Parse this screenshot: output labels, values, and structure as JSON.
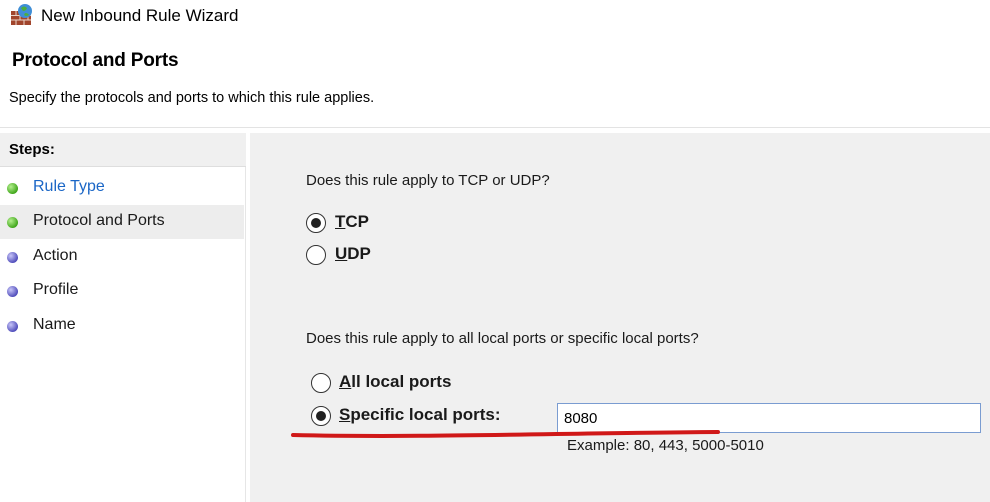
{
  "window": {
    "title": "New Inbound Rule Wizard",
    "icon": "firewall-rule-icon"
  },
  "header": {
    "title": "Protocol and Ports",
    "subtitle": "Specify the protocols and ports to which this rule applies."
  },
  "steps": {
    "title": "Steps:",
    "items": [
      {
        "label": "Rule Type",
        "state": "link",
        "dot": "green"
      },
      {
        "label": "Protocol and Ports",
        "state": "current",
        "dot": "green"
      },
      {
        "label": "Action",
        "state": "pending",
        "dot": "blue"
      },
      {
        "label": "Profile",
        "state": "pending",
        "dot": "blue"
      },
      {
        "label": "Name",
        "state": "pending",
        "dot": "blue"
      }
    ]
  },
  "protocol": {
    "question": "Does this rule apply to TCP or UDP?",
    "options": [
      {
        "underline": "T",
        "rest": "CP",
        "checked": true
      },
      {
        "underline": "U",
        "rest": "DP",
        "checked": false
      }
    ]
  },
  "ports": {
    "question": "Does this rule apply to all local ports or specific local ports?",
    "all": {
      "underline": "A",
      "rest": "ll local ports",
      "checked": false
    },
    "specific": {
      "underline": "S",
      "rest": "pecific local ports:",
      "checked": true
    },
    "value": "8080",
    "example": "Example: 80, 443, 5000-5010"
  },
  "colors": {
    "link": "#1a66c6",
    "annotation": "#d01818",
    "panel_bg": "#f0f0f0"
  }
}
